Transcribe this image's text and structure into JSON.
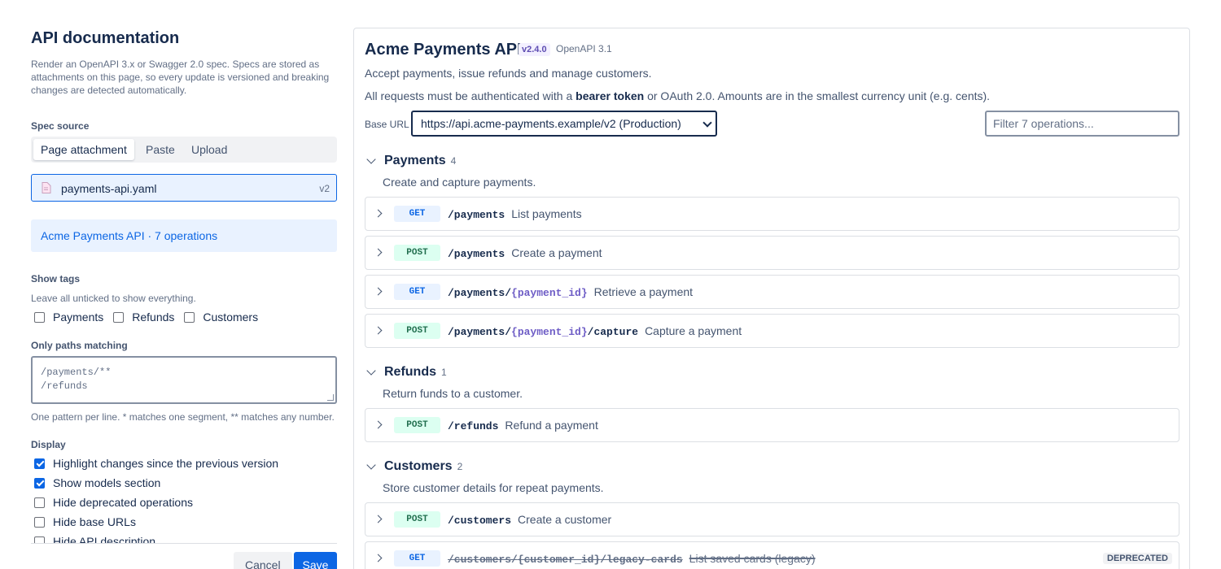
{
  "config": {
    "title": "API documentation",
    "description": "Render an OpenAPI 3.x or Swagger 2.0 spec. Specs are stored as attachments on this page, so every update is versioned and breaking changes are detected automatically.",
    "spec_source_label": "Spec source",
    "tabs": [
      {
        "label": "Page attachment",
        "active": true
      },
      {
        "label": "Paste",
        "active": false
      },
      {
        "label": "Upload",
        "active": false
      }
    ],
    "file": {
      "name": "payments-api.yaml",
      "version": "v2",
      "icon": "file-icon"
    },
    "spec_info": "Acme Payments API · 7 operations",
    "show_tags": {
      "label": "Show tags",
      "hint": "Leave all unticked to show everything.",
      "options": [
        {
          "label": "Payments",
          "checked": false
        },
        {
          "label": "Refunds",
          "checked": false
        },
        {
          "label": "Customers",
          "checked": false
        }
      ]
    },
    "paths": {
      "label": "Only paths matching",
      "value": "/payments/**\n/refunds",
      "hint": "One pattern per line. * matches one segment, ** matches any number."
    },
    "display": {
      "label": "Display",
      "options": [
        {
          "label": "Highlight changes since the previous version",
          "checked": true
        },
        {
          "label": "Show models section",
          "checked": true
        },
        {
          "label": "Hide deprecated operations",
          "checked": false
        },
        {
          "label": "Hide base URLs",
          "checked": false
        },
        {
          "label": "Hide API description",
          "checked": false
        }
      ]
    },
    "cancel_label": "Cancel",
    "save_label": "Save"
  },
  "preview": {
    "title": "Acme Payments API",
    "version": "v2.4.0",
    "spec_version": "OpenAPI 3.1",
    "summary": "Accept payments, issue refunds and manage customers.",
    "auth_prefix": "All requests must be authenticated with a ",
    "auth_bold": "bearer token",
    "auth_suffix": " or OAuth 2.0. Amounts are in the smallest currency unit (e.g. cents).",
    "base_url_label": "Base URL",
    "base_url_value": "https://api.acme-payments.example/v2 (Production)",
    "filter_placeholder": "Filter 7 operations...",
    "groups": [
      {
        "name": "Payments",
        "count": "4",
        "description": "Create and capture payments.",
        "operations": [
          {
            "method": "GET",
            "path": "/payments",
            "summary": "List payments"
          },
          {
            "method": "POST",
            "path": "/payments",
            "summary": "Create a payment"
          },
          {
            "method": "GET",
            "path_prefix": "/payments/",
            "path_param": "{payment_id}",
            "path_suffix": "",
            "summary": "Retrieve a payment"
          },
          {
            "method": "POST",
            "path_prefix": "/payments/",
            "path_param": "{payment_id}",
            "path_suffix": "/capture",
            "summary": "Capture a payment"
          }
        ]
      },
      {
        "name": "Refunds",
        "count": "1",
        "description": "Return funds to a customer.",
        "operations": [
          {
            "method": "POST",
            "path": "/refunds",
            "summary": "Refund a payment"
          }
        ]
      },
      {
        "name": "Customers",
        "count": "2",
        "description": "Store customer details for repeat payments.",
        "operations": [
          {
            "method": "POST",
            "path": "/customers",
            "summary": "Create a customer"
          },
          {
            "method": "GET",
            "path_prefix": "/customers/",
            "path_param": "{customer_id}",
            "path_suffix": "/legacy-cards",
            "summary": "List saved cards (legacy)",
            "badge": "DEPRECATED"
          }
        ]
      }
    ]
  },
  "colors": {
    "accent": "#0c66e4",
    "get": "#0c66e4",
    "post": "#216e4e",
    "param": "#6e5dc6",
    "version_badge": "#5e4db2"
  }
}
